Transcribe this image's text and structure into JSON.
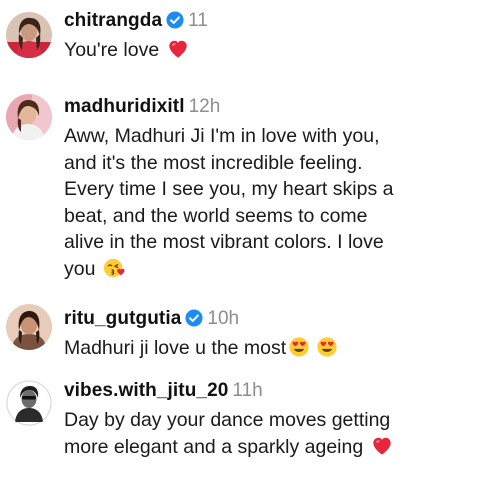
{
  "comments": [
    {
      "username": "chitrangda",
      "verified": true,
      "time": "11",
      "text": "You're love",
      "emojis": [
        "red-heart-icon"
      ]
    },
    {
      "username": "madhuridixitl",
      "verified": false,
      "time": "12h",
      "text": "Aww, Madhuri Ji I'm in love with you, and it's the most incredible feeling. Every time I see you, my heart skips a beat, and the world seems to come alive in the most vibrant colors. I love you",
      "emojis": [
        "face-blowing-kiss-icon"
      ]
    },
    {
      "username": "ritu_gutgutia",
      "verified": true,
      "time": "10h",
      "text": "Madhuri ji love u the most",
      "emojis": [
        "smiling-face-heart-eyes-icon",
        "smiling-face-heart-eyes-icon"
      ]
    },
    {
      "username": "vibes.with_jitu_20",
      "verified": false,
      "time": "11h",
      "text": "Day by day your dance moves getting more elegant and a sparkly ageing",
      "emojis": [
        "red-heart-icon"
      ]
    }
  ]
}
